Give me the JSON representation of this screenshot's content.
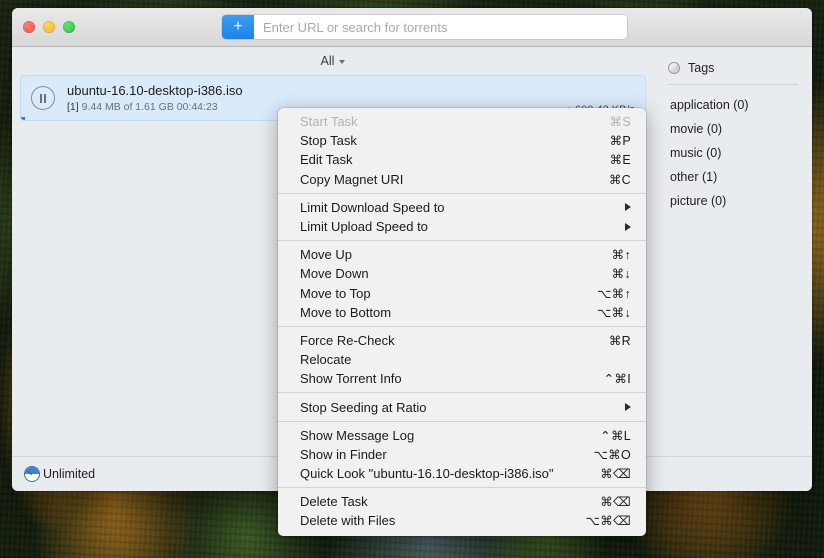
{
  "window": {
    "traffic_lights": [
      "close",
      "minimize",
      "zoom"
    ],
    "url_field": {
      "placeholder": "Enter URL or search for torrents",
      "value": "",
      "add_button_label": "+"
    }
  },
  "filter": {
    "label": "All"
  },
  "task": {
    "title": "ubuntu-16.10-desktop-i386.iso",
    "index": "[1]",
    "detail": "9.44 MB of 1.61 GB 00:44:23",
    "speed": "↓ 600.43 KB/s",
    "state_icon": "pause-icon",
    "progress_percent": 0.57
  },
  "sidebar": {
    "header": "Tags",
    "header_icon": "ring-icon",
    "tags": [
      {
        "label": "application (0)"
      },
      {
        "label": "movie (0)"
      },
      {
        "label": "music (0)"
      },
      {
        "label": "other (1)"
      },
      {
        "label": "picture (0)"
      }
    ]
  },
  "statusbar": {
    "icon": "speed-gauge-icon",
    "label": "Unlimited"
  },
  "context_menu": {
    "groups": [
      {
        "items": [
          {
            "label": "Start Task",
            "shortcut": "⌘S",
            "disabled": true,
            "submenu": false
          },
          {
            "label": "Stop Task",
            "shortcut": "⌘P",
            "disabled": false,
            "submenu": false
          },
          {
            "label": "Edit Task",
            "shortcut": "⌘E",
            "disabled": false,
            "submenu": false
          },
          {
            "label": "Copy Magnet URI",
            "shortcut": "⌘C",
            "disabled": false,
            "submenu": false
          }
        ]
      },
      {
        "items": [
          {
            "label": "Limit Download Speed to",
            "shortcut": "",
            "disabled": false,
            "submenu": true
          },
          {
            "label": "Limit Upload Speed to",
            "shortcut": "",
            "disabled": false,
            "submenu": true
          }
        ]
      },
      {
        "items": [
          {
            "label": "Move Up",
            "shortcut": "⌘↑",
            "disabled": false,
            "submenu": false
          },
          {
            "label": "Move Down",
            "shortcut": "⌘↓",
            "disabled": false,
            "submenu": false
          },
          {
            "label": "Move to Top",
            "shortcut": "⌥⌘↑",
            "disabled": false,
            "submenu": false
          },
          {
            "label": "Move to Bottom",
            "shortcut": "⌥⌘↓",
            "disabled": false,
            "submenu": false
          }
        ]
      },
      {
        "items": [
          {
            "label": "Force Re-Check",
            "shortcut": "⌘R",
            "disabled": false,
            "submenu": false
          },
          {
            "label": "Relocate",
            "shortcut": "",
            "disabled": false,
            "submenu": false
          },
          {
            "label": "Show Torrent Info",
            "shortcut": "⌃⌘I",
            "disabled": false,
            "submenu": false
          }
        ]
      },
      {
        "items": [
          {
            "label": "Stop Seeding at Ratio",
            "shortcut": "",
            "disabled": false,
            "submenu": true
          }
        ]
      },
      {
        "items": [
          {
            "label": "Show Message Log",
            "shortcut": "⌃⌘L",
            "disabled": false,
            "submenu": false
          },
          {
            "label": "Show in Finder",
            "shortcut": "⌥⌘O",
            "disabled": false,
            "submenu": false
          },
          {
            "label": "Quick Look \"ubuntu-16.10-desktop-i386.iso\"",
            "shortcut": "⌘⌫",
            "disabled": false,
            "submenu": false
          }
        ]
      },
      {
        "items": [
          {
            "label": "Delete Task",
            "shortcut": "⌘⌫",
            "disabled": false,
            "submenu": false
          },
          {
            "label": "Delete with Files",
            "shortcut": "⌥⌘⌫",
            "disabled": false,
            "submenu": false
          }
        ]
      }
    ]
  },
  "colors": {
    "accent_blue": "#1e82e8",
    "selection_blue": "#d9eafb",
    "progress_blue": "#2f7fd4",
    "window_chrome": "#e9ecef",
    "menu_bg": "#f1f1f1"
  }
}
